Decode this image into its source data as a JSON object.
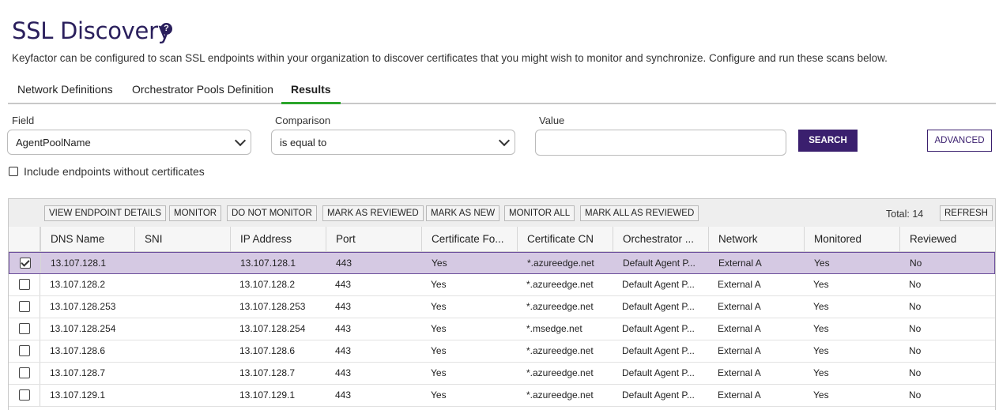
{
  "page": {
    "title": "SSL Discovery",
    "help_icon": "?",
    "description": "Keyfactor can be configured to scan SSL endpoints within your organization to discover certificates that you might wish to monitor and synchronize. Configure and run these scans below."
  },
  "tabs": [
    {
      "label": "Network Definitions",
      "active": false
    },
    {
      "label": "Orchestrator Pools Definition",
      "active": false
    },
    {
      "label": "Results",
      "active": true
    }
  ],
  "filter": {
    "field_label": "Field",
    "field_value": "AgentPoolName",
    "comparison_label": "Comparison",
    "comparison_value": "is equal to",
    "value_label": "Value",
    "value_value": "",
    "search_label": "SEARCH",
    "advanced_label": "ADVANCED",
    "include_label": "Include endpoints without certificates",
    "include_checked": false
  },
  "toolbar": {
    "buttons": [
      "VIEW ENDPOINT DETAILS",
      "MONITOR",
      "DO NOT MONITOR",
      "MARK AS REVIEWED",
      "MARK AS NEW",
      "MONITOR ALL",
      "MARK ALL AS REVIEWED"
    ],
    "total_label": "Total: 14",
    "refresh_label": "REFRESH"
  },
  "table": {
    "columns": [
      "DNS Name",
      "SNI",
      "IP Address",
      "Port",
      "Certificate Fo...",
      "Certificate CN",
      "Orchestrator ...",
      "Network",
      "Monitored",
      "Reviewed"
    ],
    "rows": [
      {
        "selected": true,
        "cells": [
          "13.107.128.1",
          "",
          "13.107.128.1",
          "443",
          "Yes",
          "*.azureedge.net",
          "Default Agent P...",
          "External A",
          "Yes",
          "No"
        ]
      },
      {
        "selected": false,
        "cells": [
          "13.107.128.2",
          "",
          "13.107.128.2",
          "443",
          "Yes",
          "*.azureedge.net",
          "Default Agent P...",
          "External A",
          "Yes",
          "No"
        ]
      },
      {
        "selected": false,
        "cells": [
          "13.107.128.253",
          "",
          "13.107.128.253",
          "443",
          "Yes",
          "*.azureedge.net",
          "Default Agent P...",
          "External A",
          "Yes",
          "No"
        ]
      },
      {
        "selected": false,
        "cells": [
          "13.107.128.254",
          "",
          "13.107.128.254",
          "443",
          "Yes",
          "*.msedge.net",
          "Default Agent P...",
          "External A",
          "Yes",
          "No"
        ]
      },
      {
        "selected": false,
        "cells": [
          "13.107.128.6",
          "",
          "13.107.128.6",
          "443",
          "Yes",
          "*.azureedge.net",
          "Default Agent P...",
          "External A",
          "Yes",
          "No"
        ]
      },
      {
        "selected": false,
        "cells": [
          "13.107.128.7",
          "",
          "13.107.128.7",
          "443",
          "Yes",
          "*.azureedge.net",
          "Default Agent P...",
          "External A",
          "Yes",
          "No"
        ]
      },
      {
        "selected": false,
        "cells": [
          "13.107.129.1",
          "",
          "13.107.129.1",
          "443",
          "Yes",
          "*.azureedge.net",
          "Default Agent P...",
          "External A",
          "Yes",
          "No"
        ]
      }
    ]
  },
  "colors": {
    "brand": "#3a1f6e",
    "title": "#2a1f5c",
    "active_tab_underline": "#2ba52b",
    "selected_row": "#d5c9e3"
  }
}
